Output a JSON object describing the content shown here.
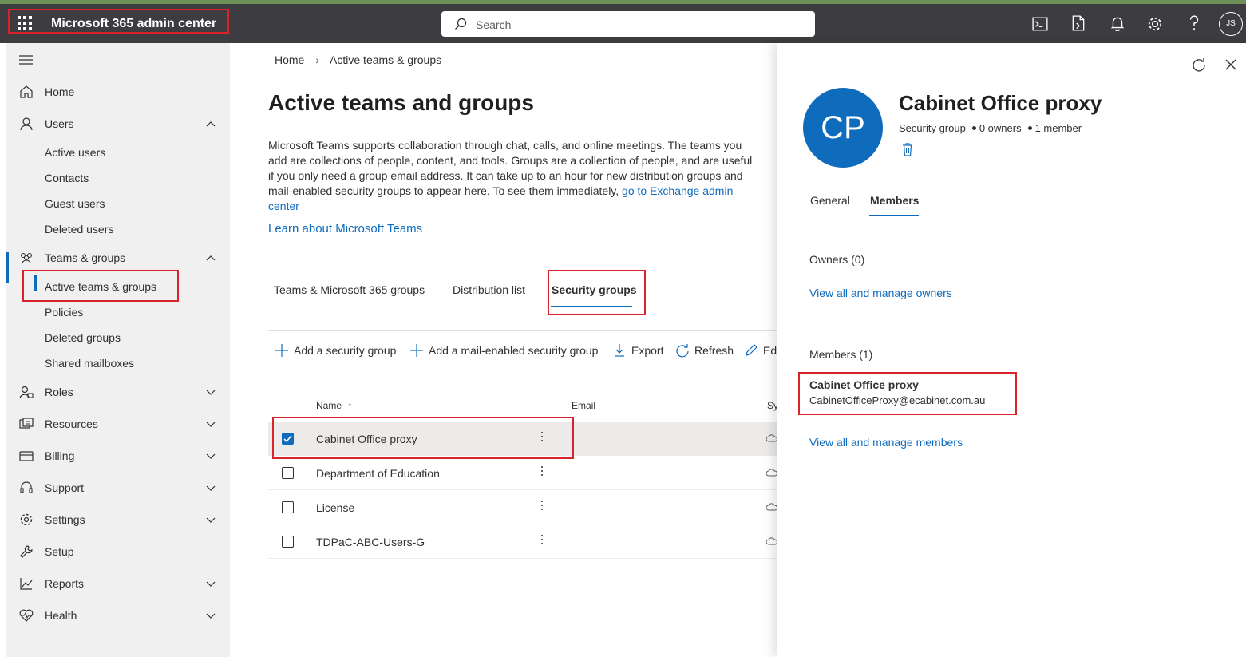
{
  "header": {
    "app_title": "Microsoft 365 admin center",
    "search_placeholder": "Search",
    "user_initials": "JS"
  },
  "sidebar": {
    "items": [
      {
        "label": "Home",
        "icon": "home-icon"
      },
      {
        "label": "Users",
        "icon": "user-icon",
        "expanded": true,
        "children": [
          "Active users",
          "Contacts",
          "Guest users",
          "Deleted users"
        ]
      },
      {
        "label": "Teams & groups",
        "icon": "teams-groups-icon",
        "expanded": true,
        "children": [
          "Active teams & groups",
          "Policies",
          "Deleted groups",
          "Shared mailboxes"
        ]
      },
      {
        "label": "Roles",
        "icon": "roles-icon"
      },
      {
        "label": "Resources",
        "icon": "resources-icon"
      },
      {
        "label": "Billing",
        "icon": "billing-icon"
      },
      {
        "label": "Support",
        "icon": "headset-icon"
      },
      {
        "label": "Settings",
        "icon": "gear-icon"
      },
      {
        "label": "Setup",
        "icon": "wrench-icon"
      },
      {
        "label": "Reports",
        "icon": "chart-icon"
      },
      {
        "label": "Health",
        "icon": "heart-icon"
      }
    ]
  },
  "breadcrumb": [
    "Home",
    "Active teams & groups"
  ],
  "page": {
    "title": "Active teams and groups",
    "description": "Microsoft Teams supports collaboration through chat, calls, and online meetings. The teams you add are collections of people, content, and tools. Groups are a collection of people, and are useful if you only need a group email address. It can take up to an hour for new distribution groups and mail-enabled security groups to appear here. To see them immediately, ",
    "description_link": "go to Exchange admin center",
    "learn_link": "Learn about Microsoft Teams"
  },
  "tabs": [
    "Teams & Microsoft 365 groups",
    "Distribution list",
    "Security groups"
  ],
  "active_tab": "Security groups",
  "commands": [
    "Add a security group",
    "Add a mail-enabled security group",
    "Export",
    "Refresh",
    "Edi"
  ],
  "table": {
    "columns": [
      "Name",
      "Email",
      "Sy"
    ],
    "rows": [
      {
        "name": "Cabinet Office proxy",
        "selected": true
      },
      {
        "name": "Department of Education",
        "selected": false
      },
      {
        "name": "License",
        "selected": false
      },
      {
        "name": "TDPaC-ABC-Users-G",
        "selected": false
      }
    ]
  },
  "panel": {
    "initials": "CP",
    "title": "Cabinet Office proxy",
    "type": "Security group",
    "owners_count": "0 owners",
    "members_count": "1 member",
    "tabs": [
      "General",
      "Members"
    ],
    "active_tab": "Members",
    "owners_heading": "Owners (0)",
    "owners_link": "View all and manage owners",
    "members_heading": "Members (1)",
    "member": {
      "name": "Cabinet Office proxy",
      "email": "CabinetOfficeProxy@ecabinet.com.au"
    },
    "members_link": "View all and manage members"
  },
  "colors": {
    "topbar": "#3c3c41",
    "accent": "#0f6cbd",
    "highlight_box": "#d9222a",
    "sidebar_bg": "#f0f0f0"
  }
}
